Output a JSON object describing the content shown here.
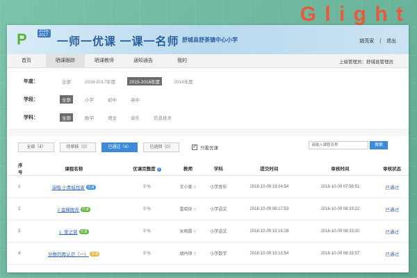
{
  "brand_mark": "G  l i g h t",
  "banner": {
    "logo_text": "P",
    "years": "2016-2017",
    "title": "一师一优课  一课一名师",
    "school": "舒城县舒茶镇中心小学",
    "user_link": "姚亮家",
    "logout": "退出"
  },
  "nav": {
    "items": [
      "首页",
      "晒课跟踪",
      "晒课教师",
      "通知通告",
      "我的"
    ],
    "active_index": 1,
    "right_text": "上级管理员：舒城县管理员"
  },
  "filters": {
    "year": {
      "label": "年度：",
      "options": [
        "全部",
        "2016-2017年度",
        "2015-2016年度",
        "2014年度"
      ],
      "selected": 2
    },
    "stage": {
      "label": "学段：",
      "options": [
        "全部",
        "小学",
        "初中",
        "高中"
      ],
      "selected": 0
    },
    "subject": {
      "label": "学科：",
      "options": [
        "全部",
        "数学",
        "语文",
        "音乐",
        "信息技术"
      ],
      "selected": 0
    }
  },
  "tabs": [
    "全部（4）",
    "待审核（0）",
    "已通过（4）",
    "已退回（0）"
  ],
  "active_tab": 2,
  "excellent_only": {
    "label": "只看优课",
    "checked": true,
    "mark": "✓"
  },
  "search": {
    "placeholder": "请输入课程名称",
    "button": "搜索"
  },
  "table": {
    "headers": [
      "序号",
      "课程名称",
      "优课完整度",
      "教师",
      "学科",
      "提交时间",
      "审核时间",
      "审核状态"
    ],
    "info_icon": "i",
    "rows": [
      {
        "no": "1",
        "course": "演唱 小青蛙找家",
        "badge": "优课",
        "badge_color": "#3d8ad8",
        "completeness": "0 %",
        "teacher": "王小美",
        "subject": "小学音乐",
        "submitted": "2016-10-09 19:24:54",
        "reviewed": "2016-10-09 07:58:51",
        "status": "已通过"
      },
      {
        "no": "2",
        "course": "2 金蝉脱壳",
        "badge": "优课",
        "badge_color": "#5ab235",
        "completeness": "0 %",
        "teacher": "雷晓琼",
        "subject": "小学语文",
        "submitted": "2016-10-09 08:17:53",
        "reviewed": "2016-10-09 08:33:22",
        "status": "已通过"
      },
      {
        "no": "3",
        "course": "1. 爱之链",
        "badge": "优课",
        "badge_color": "#5ab235",
        "completeness": "0 %",
        "teacher": "吴明霞",
        "subject": "小学语文",
        "submitted": "2016-10-09 15:16:28",
        "reviewed": "2016-10-09 08:33:10",
        "status": "已通过"
      },
      {
        "no": "4",
        "course": "分数的再认识（一）",
        "badge": "优课",
        "badge_color": "#e8b53a",
        "completeness": "0 %",
        "teacher": "胡丹琪",
        "subject": "小学数学",
        "submitted": "2016-10-09 15:13:54",
        "reviewed": "2016-10-09 08:33:57",
        "status": "已通过"
      }
    ],
    "teacher_mark": "▽"
  }
}
